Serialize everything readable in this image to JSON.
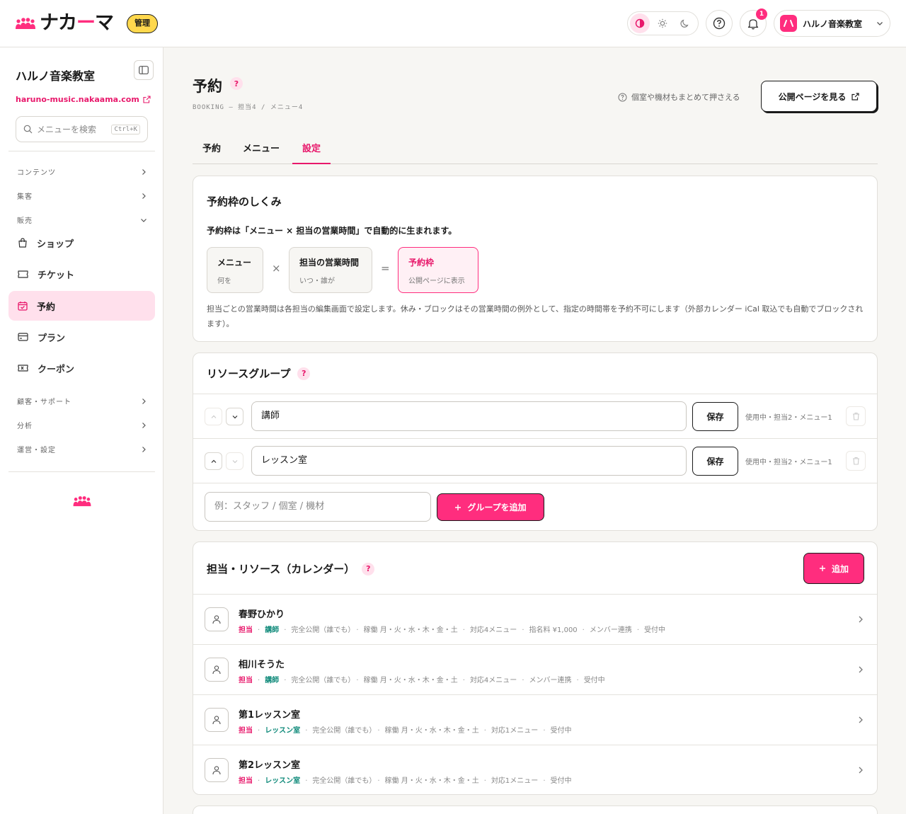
{
  "header": {
    "logo_text_1": "ナカ",
    "logo_text_dash": "ー",
    "logo_text_2": "マ",
    "admin_badge": "管理",
    "notification_count": "1",
    "account_name": "ハルノ音楽教室",
    "account_avatar_glyph": "ハ"
  },
  "sidebar": {
    "title": "ハルノ音楽教室",
    "domain": "haruno-music.nakaama.com",
    "search_placeholder": "メニューを検索",
    "search_shortcut": "Ctrl+K",
    "sections": {
      "contents": "コンテンツ",
      "marketing": "集客",
      "sales": "販売",
      "customer": "顧客・サポート",
      "analytics": "分析",
      "operations": "運営・設定"
    },
    "items": {
      "shop": "ショップ",
      "ticket": "チケット",
      "booking": "予約",
      "plan": "プラン",
      "coupon": "クーポン"
    }
  },
  "page": {
    "title": "予約",
    "breadcrumb": "BOOKING — 担当4 / メニュー4",
    "hint": "個室や機材もまとめて押さえる",
    "public_button": "公開ページを見る",
    "tabs": [
      "予約",
      "メニュー",
      "設定"
    ],
    "active_tab": "設定"
  },
  "mechanism": {
    "title": "予約枠のしくみ",
    "lead": "予約枠は「メニュー × 担当の営業時間」で自動的に生まれます。",
    "box_menu_title": "メニュー",
    "box_menu_sub": "何を",
    "box_hours_title": "担当の営業時間",
    "box_hours_sub": "いつ・誰が",
    "box_slot_title": "予約枠",
    "box_slot_sub": "公開ページに表示",
    "op_times": "×",
    "op_equals": "=",
    "note": "担当ごとの営業時間は各担当の編集画面で設定します。休み・ブロックはその営業時間の例外として、指定の時間帯を予約不可にします（外部カレンダー iCal 取込でも自動でブロックされます）。"
  },
  "resource_groups": {
    "title": "リソースグループ",
    "save_label": "保存",
    "rows": [
      {
        "name": "講師",
        "meta": "使用中・担当2・メニュー1"
      },
      {
        "name": "レッスン室",
        "meta": "使用中・担当2・メニュー1"
      }
    ],
    "add_placeholder": "例：スタッフ / 個室 / 機材",
    "add_button": "グループを追加"
  },
  "resources": {
    "title": "担当・リソース（カレンダー）",
    "add_button": "追加",
    "rows": [
      {
        "name": "春野ひかり",
        "kind": "担当",
        "group": "講師",
        "visibility": "完全公開（誰でも）",
        "days": "稼働 月・火・水・木・金・土",
        "menus": "対応4メニュー",
        "fee": "指名料 ¥1,000",
        "link": "メンバー連携",
        "status": "受付中"
      },
      {
        "name": "相川そうた",
        "kind": "担当",
        "group": "講師",
        "visibility": "完全公開（誰でも）",
        "days": "稼働 月・火・水・木・金・土",
        "menus": "対応4メニュー",
        "link": "メンバー連携",
        "status": "受付中"
      },
      {
        "name": "第1レッスン室",
        "kind": "担当",
        "group": "レッスン室",
        "visibility": "完全公開（誰でも）",
        "days": "稼働 月・火・水・木・金・土",
        "menus": "対応1メニュー",
        "status": "受付中"
      },
      {
        "name": "第2レッスン室",
        "kind": "担当",
        "group": "レッスン室",
        "visibility": "完全公開（誰でも）",
        "days": "稼働 月・火・水・木・金・土",
        "menus": "対応1メニュー",
        "status": "受付中"
      }
    ]
  },
  "colors": {
    "accent": "#ff2d7e",
    "accent_text": "#e8186b",
    "group_text": "#0f8a7a",
    "badge": "#ffd84d"
  }
}
